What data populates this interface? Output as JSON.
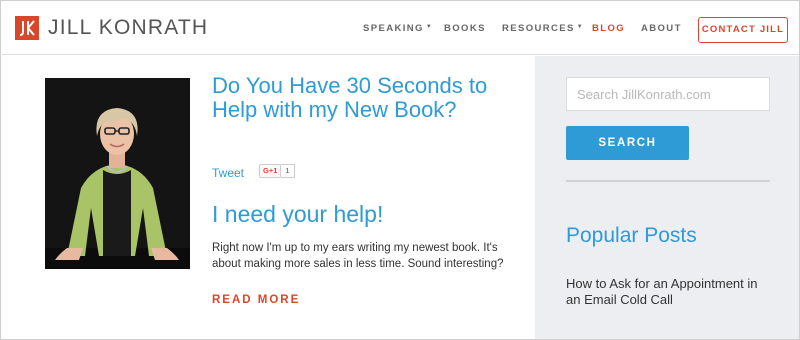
{
  "brand": {
    "name": "JILL KONRATH",
    "logo_color": "#d9472b"
  },
  "nav": {
    "items": [
      {
        "label": "SPEAKING",
        "has_dropdown": true
      },
      {
        "label": "BOOKS",
        "has_dropdown": false
      },
      {
        "label": "RESOURCES",
        "has_dropdown": true
      },
      {
        "label": "BLOG",
        "has_dropdown": false,
        "active": true
      },
      {
        "label": "ABOUT",
        "has_dropdown": false
      }
    ],
    "contact_label": "CONTACT JILL",
    "caret": "▼"
  },
  "post": {
    "title": "Do You Have 30 Seconds to Help with my New Book?",
    "tweet_label": "Tweet",
    "gplus_label": "G+1",
    "gplus_count": "1",
    "subheading": "I need your help!",
    "excerpt": "Right now I'm up to my ears writing my newest book. It's about making more sales in less time. Sound interesting?",
    "read_more": "READ MORE"
  },
  "sidebar": {
    "search_placeholder": "Search JillKonrath.com",
    "search_button": "SEARCH",
    "popular_title": "Popular Posts",
    "popular_items": [
      "How to Ask for an Appointment in an Email Cold Call"
    ]
  },
  "colors": {
    "accent_blue": "#2e9bd6",
    "accent_red": "#d9472b",
    "sidebar_bg": "#eceef1"
  }
}
